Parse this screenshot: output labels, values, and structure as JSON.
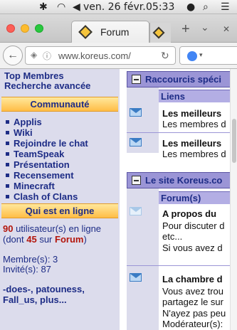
{
  "menubar": {
    "date": "ven. 26 févr.",
    "time": "05:33"
  },
  "browser": {
    "active_tab_title": "Forum",
    "url": "www.koreus.com/",
    "new_tab": "+",
    "tab_dropdown": "⌄",
    "tab_close": "✕"
  },
  "sidebar": {
    "top_links": [
      "Top Membres",
      "Recherche avancée"
    ],
    "communaute_header": "Communauté",
    "communaute_items": [
      "Applis",
      "Wiki",
      "Rejoindre le chat",
      "TeamSpeak",
      "Présentation",
      "Recensement",
      "Minecraft",
      "Clash of Clans"
    ],
    "online_header": "Qui est en ligne",
    "online_count": "90",
    "online_text_1": " utilisateur(s) en ligne",
    "online_text_2a": "(dont ",
    "online_forum_count": "45",
    "online_text_2b": " sur ",
    "online_forum_label": "Forum",
    "online_text_2c": ")",
    "members": "Membre(s): 3",
    "guests": "Invité(s): 87",
    "member_names_1": "-does-, patouness,",
    "member_names_2": "Fall_us, plus..."
  },
  "panels": {
    "raccourcis": {
      "title": "Raccourcis spéci",
      "col": "Liens",
      "rows": [
        {
          "title": "Les meilleurs",
          "sub": "Les membres d"
        },
        {
          "title": "Les meilleurs",
          "sub": "Les membres d"
        }
      ]
    },
    "site": {
      "title": "Le site Koreus.co",
      "col": "Forum(s)",
      "rows": [
        {
          "title": "A propos du",
          "lines": [
            "Pour discuter d",
            "etc...",
            "Si vous avez d"
          ]
        },
        {
          "title": "La chambre d",
          "lines": [
            "Vous avez trou",
            "partagez le sur",
            "N'ayez pas peu",
            "Modérateur(s):"
          ]
        }
      ]
    }
  }
}
